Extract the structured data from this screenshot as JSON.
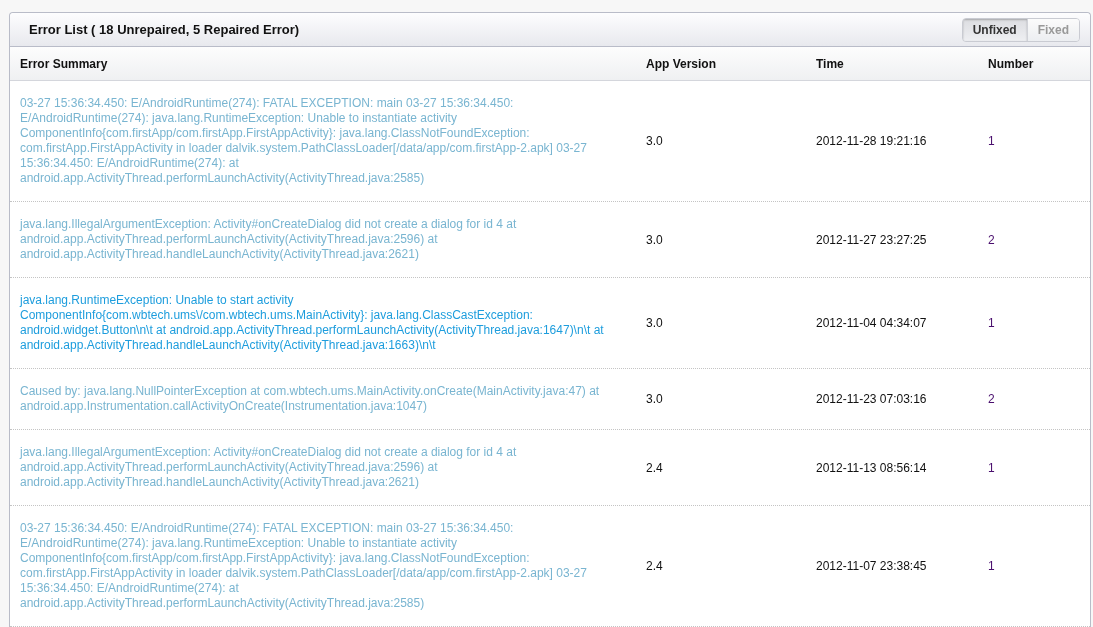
{
  "panel": {
    "title": "Error List ( 18  Unrepaired, 5  Repaired  Error)"
  },
  "filters": [
    {
      "label": "Unfixed",
      "selected": true
    },
    {
      "label": "Fixed",
      "selected": false
    }
  ],
  "table": {
    "columns": [
      "Error Summary",
      "App Version",
      "Time",
      "Number"
    ],
    "rows": [
      {
        "summary": "03-27 15:36:34.450: E/AndroidRuntime(274): FATAL EXCEPTION: main 03-27 15:36:34.450: E/AndroidRuntime(274): java.lang.RuntimeException: Unable to instantiate activity ComponentInfo{com.firstApp/com.firstApp.FirstAppActivity}: java.lang.ClassNotFoundException: com.firstApp.FirstAppActivity in loader dalvik.system.PathClassLoader[/data/app/com.firstApp-2.apk] 03-27 15:36:34.450: E/AndroidRuntime(274): at android.app.ActivityThread.performLaunchActivity(ActivityThread.java:2585)",
        "visited": true,
        "version": "3.0",
        "time": "2012-11-28 19:21:16",
        "number": "1"
      },
      {
        "summary": "java.lang.IllegalArgumentException: Activity#onCreateDialog did not create a dialog for id 4 at android.app.ActivityThread.performLaunchActivity(ActivityThread.java:2596) at android.app.ActivityThread.handleLaunchActivity(ActivityThread.java:2621)",
        "visited": true,
        "version": "3.0",
        "time": "2012-11-27 23:27:25",
        "number": "2"
      },
      {
        "summary": "java.lang.RuntimeException: Unable to start activity ComponentInfo{com.wbtech.ums\\/com.wbtech.ums.MainActivity}: java.lang.ClassCastException: android.widget.Button\\n\\t at android.app.ActivityThread.performLaunchActivity(ActivityThread.java:1647)\\n\\t at android.app.ActivityThread.handleLaunchActivity(ActivityThread.java:1663)\\n\\t",
        "visited": false,
        "version": "3.0",
        "time": "2012-11-04 04:34:07",
        "number": "1"
      },
      {
        "summary": "Caused by: java.lang.NullPointerException at com.wbtech.ums.MainActivity.onCreate(MainActivity.java:47) at android.app.Instrumentation.callActivityOnCreate(Instrumentation.java:1047)",
        "visited": true,
        "version": "3.0",
        "time": "2012-11-23 07:03:16",
        "number": "2"
      },
      {
        "summary": "java.lang.IllegalArgumentException: Activity#onCreateDialog did not create a dialog for id 4 at android.app.ActivityThread.performLaunchActivity(ActivityThread.java:2596) at android.app.ActivityThread.handleLaunchActivity(ActivityThread.java:2621)",
        "visited": true,
        "version": "2.4",
        "time": "2012-11-13 08:56:14",
        "number": "1"
      },
      {
        "summary": "03-27 15:36:34.450: E/AndroidRuntime(274): FATAL EXCEPTION: main 03-27 15:36:34.450: E/AndroidRuntime(274): java.lang.RuntimeException: Unable to instantiate activity ComponentInfo{com.firstApp/com.firstApp.FirstAppActivity}: java.lang.ClassNotFoundException: com.firstApp.FirstAppActivity in loader dalvik.system.PathClassLoader[/data/app/com.firstApp-2.apk] 03-27 15:36:34.450: E/AndroidRuntime(274): at android.app.ActivityThread.performLaunchActivity(ActivityThread.java:2585)",
        "visited": true,
        "version": "2.4",
        "time": "2012-11-07 23:38:45",
        "number": "1"
      }
    ]
  }
}
